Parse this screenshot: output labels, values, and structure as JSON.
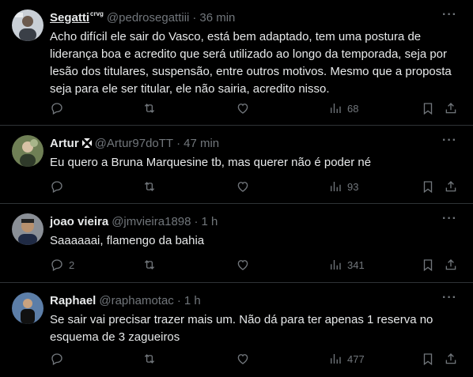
{
  "tweets": [
    {
      "name": "Segatti",
      "name_sup": "crvg",
      "handle": "@pedrosegattiii",
      "sep": "·",
      "time": "36 min",
      "text": "Acho difícil ele sair do Vasco, está bem adaptado, tem uma postura de liderança boa e acredito que será utilizado ao longo da temporada, seja por lesão dos titulares, suspensão, entre outros motivos. Mesmo que a proposta seja para ele ser titular, ele não sairia, acredito nisso.",
      "replies": "",
      "views": "68"
    },
    {
      "name": "Artur",
      "handle": "@Artur97doTT",
      "sep": "·",
      "time": "47 min",
      "text": "Eu quero a Bruna Marquesine tb, mas querer não é poder né",
      "replies": "",
      "views": "93"
    },
    {
      "name": "joao vieira",
      "handle": "@jmvieira1898",
      "sep": "·",
      "time": "1 h",
      "text": "Saaaaaai, flamengo da bahia",
      "replies": "2",
      "views": "341"
    },
    {
      "name": "Raphael",
      "handle": "@raphamotac",
      "sep": "·",
      "time": "1 h",
      "text": "Se sair vai precisar trazer mais um. Não dá para ter apenas 1 reserva no esquema de 3 zagueiros",
      "replies": "",
      "views": "477"
    }
  ],
  "more_label": "···",
  "colors": {
    "background": "#000000",
    "text": "#e7e9ea",
    "muted": "#71767b",
    "divider": "#2f3336"
  },
  "icons": [
    "reply-icon",
    "retweet-icon",
    "like-icon",
    "views-icon",
    "bookmark-icon",
    "share-icon",
    "more-icon"
  ]
}
